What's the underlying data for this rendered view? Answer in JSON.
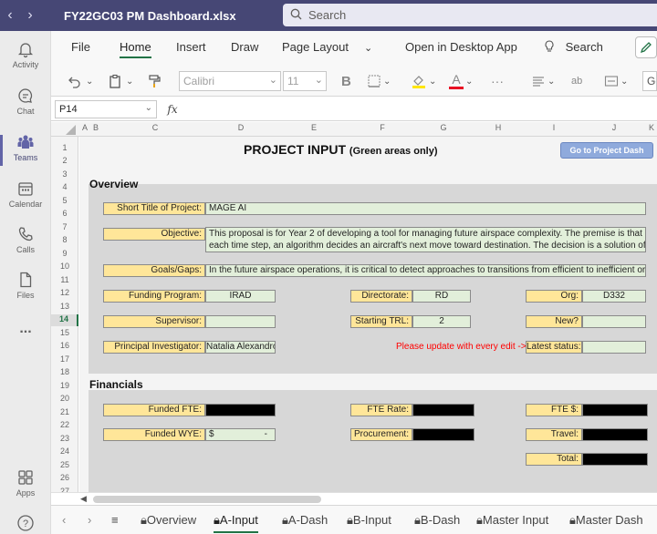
{
  "titlebar": {
    "back": "‹",
    "forward": "›",
    "file_name": "FY22GC03 PM Dashboard.xlsx",
    "search_placeholder": "Search"
  },
  "rail": {
    "items": [
      {
        "label": "Activity",
        "icon": "bell-icon"
      },
      {
        "label": "Chat",
        "icon": "chat-icon"
      },
      {
        "label": "Teams",
        "icon": "teams-icon"
      },
      {
        "label": "Calendar",
        "icon": "calendar-icon"
      },
      {
        "label": "Calls",
        "icon": "phone-icon"
      },
      {
        "label": "Files",
        "icon": "file-icon"
      },
      {
        "label": "...",
        "icon": "more-icon"
      },
      {
        "label": "Apps",
        "icon": "apps-icon"
      }
    ],
    "help": "?"
  },
  "ribbon": {
    "tabs": [
      "File",
      "Home",
      "Insert",
      "Draw",
      "Page Layout",
      "Open in Desktop App",
      "Search"
    ],
    "font_name": "Calibri",
    "font_size": "11",
    "bold": "B",
    "ab": "ab",
    "more": "···",
    "font_letter": "A",
    "partial": "Ge"
  },
  "formula_bar": {
    "cell_ref": "P14",
    "fx": "fx",
    "value": ""
  },
  "columns": [
    "A",
    "B",
    "C",
    "D",
    "E",
    "F",
    "G",
    "H",
    "I",
    "J",
    "K"
  ],
  "rows": [
    "1",
    "2",
    "3",
    "4",
    "5",
    "6",
    "7",
    "8",
    "9",
    "10",
    "11",
    "12",
    "13",
    "14",
    "15",
    "16",
    "17",
    "18",
    "19",
    "20",
    "21",
    "22",
    "23",
    "24",
    "25",
    "26",
    "27"
  ],
  "selected_row": "14",
  "sheet": {
    "title": "PROJECT INPUT",
    "title_note": "(Green areas only)",
    "go_button": "Go to Project Dash",
    "overview": {
      "heading": "Overview",
      "short_title_label": "Short Title of Project:",
      "short_title": "MAGE AI",
      "objective_label": "Objective:",
      "objective_line1": "This proposal is for Year 2 of developing a tool for managing future airspace complexity. The premise is that at",
      "objective_line2": "each time step, an algorithm decides an aircraft's next move toward destination. The decision is a solution of a",
      "goals_label": "Goals/Gaps:",
      "goals": "In the future airspace operations, it is critical to detect approaches to transitions from efficient to inefficient or ev",
      "funding_program_label": "Funding Program:",
      "funding_program": "IRAD",
      "directorate_label": "Directorate:",
      "directorate": "RD",
      "org_label": "Org:",
      "org": "D332",
      "supervisor_label": "Supervisor:",
      "supervisor": "",
      "starting_trl_label": "Starting TRL:",
      "starting_trl": "2",
      "new_label": "New?",
      "new_value": "",
      "pi_label": "Principal Investigator:",
      "pi": "Natalia Alexandrov",
      "update_note": "Please update with every edit ->",
      "latest_status_label": "Latest status:",
      "latest_status": ""
    },
    "financials": {
      "heading": "Financials",
      "funded_fte_label": "Funded FTE:",
      "fte_rate_label": "FTE Rate:",
      "fte_dollars_label": "FTE $:",
      "funded_wye_label": "Funded WYE:",
      "funded_wye_currency": "$",
      "funded_wye_value": "-",
      "procurement_label": "Procurement:",
      "travel_label": "Travel:",
      "total_label": "Total:"
    }
  },
  "sheet_tabs": {
    "menu": "≡",
    "tabs": [
      "Overview",
      "A-Input",
      "A-Dash",
      "B-Input",
      "B-Dash",
      "Master Input",
      "Master Dash"
    ],
    "active": "A-Input"
  },
  "colors": {
    "titlebar": "#464775",
    "label_fill": "#ffe699",
    "value_fill": "#e2efda",
    "excel_green": "#217346",
    "note_red": "#ff0000",
    "button_blue": "#8faadc"
  }
}
